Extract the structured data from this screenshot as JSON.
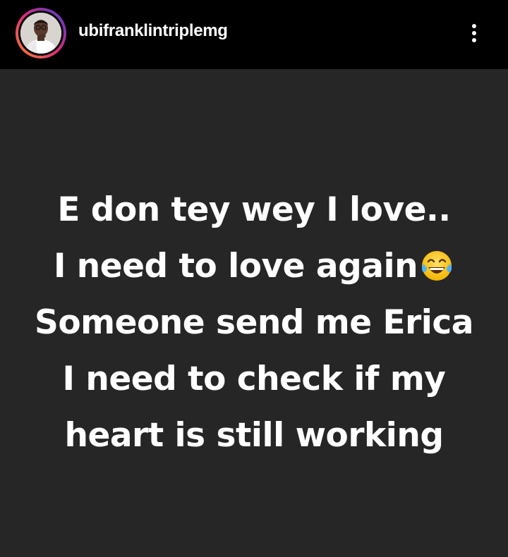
{
  "header": {
    "username": "ubifranklintriplemg",
    "avatar_icon": "avatar-icon",
    "more_icon": "more-vertical-icon"
  },
  "story": {
    "lines": [
      "E don tey wey I love..",
      "I need to love again",
      "Someone send me Erica",
      "I need to check if my",
      "heart is still working"
    ],
    "emoji": "face-with-tears-of-joy-icon"
  },
  "colors": {
    "header_bg": "#000000",
    "story_bg": "#262626",
    "text": "#ffffff",
    "ring_gradient": [
      "#f58529",
      "#dd2a7b",
      "#8134af",
      "#515bd4"
    ]
  }
}
